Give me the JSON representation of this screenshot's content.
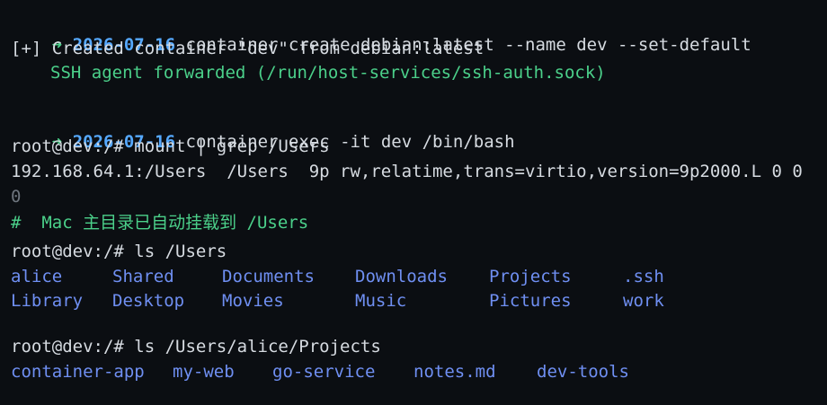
{
  "terminal": {
    "lines": {
      "cmd1": {
        "arrow": "➜",
        "date": "2026-07-16",
        "command": "container create debian:latest --name dev --set-default"
      },
      "out1": "[+] Created container \"dev\" from debian:latest",
      "out2": "SSH agent forwarded (/run/host-services/ssh-auth.sock)",
      "cmd2": {
        "arrow": "➜",
        "date": "2026-07-16",
        "command": "container exec -it dev /bin/bash"
      },
      "prompt1": "root@dev:/# mount | grep /Users",
      "mount_line": "192.168.64.1:/Users  /Users  9p rw,relatime,trans=virtio,version=9p2000.L 0 0",
      "mount_wrap": "0",
      "comment": "#  Mac 主目录已自动挂载到 /Users",
      "prompt2": "root@dev:/# ls /Users",
      "users_row1": [
        "alice",
        "Shared",
        "Documents",
        "Downloads",
        "Projects",
        ".ssh"
      ],
      "users_row2": [
        "Library",
        "Desktop",
        "Movies",
        "Music",
        "Pictures",
        "work"
      ],
      "prompt3": "root@dev:/# ls /Users/alice/Projects",
      "projects": [
        "container-app",
        "my-web",
        "go-service",
        "notes.md",
        "dev-tools"
      ]
    }
  },
  "colors": {
    "background": "#0b0e12",
    "text": "#d6dbe1",
    "green": "#4bd08a",
    "date_blue": "#56a9ff",
    "dir_blue": "#6f8ff2"
  }
}
